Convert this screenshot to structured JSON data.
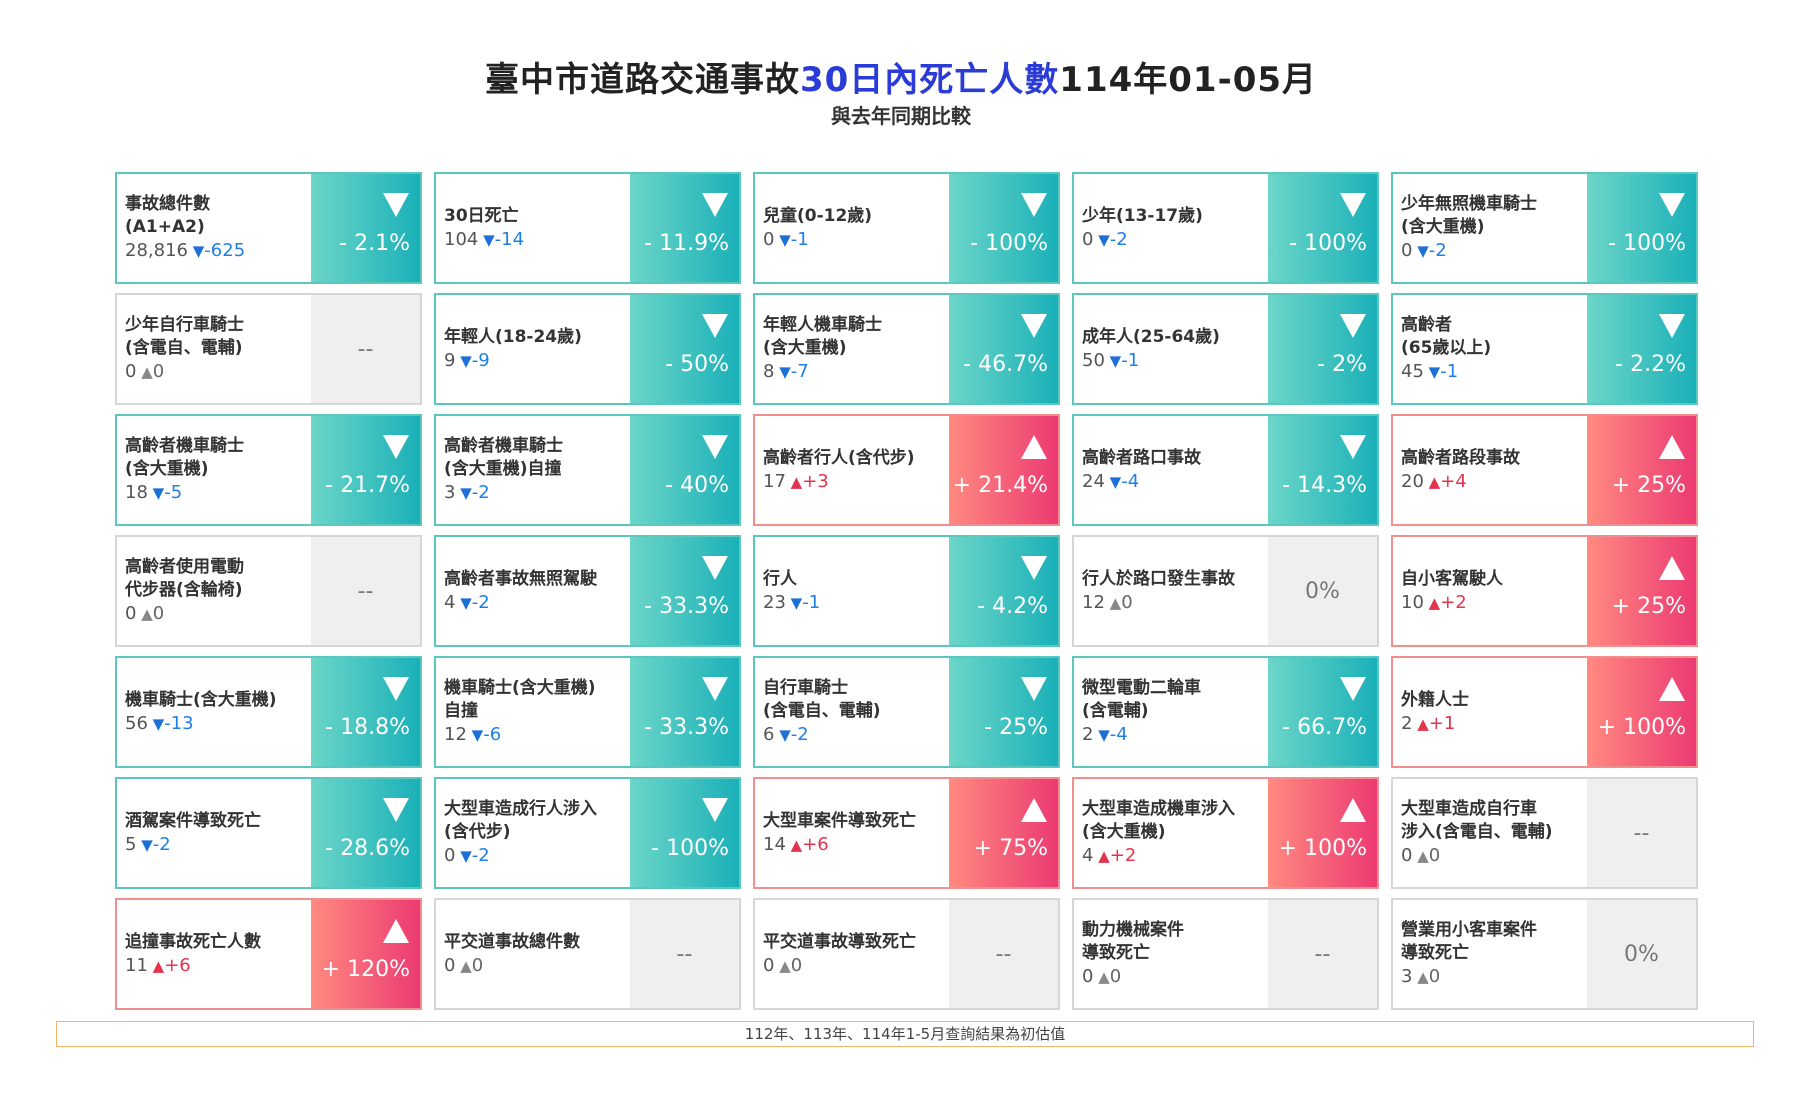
{
  "header": {
    "title_prefix": "臺中市道路交通事故",
    "title_highlight": "30日內死亡人數",
    "title_suffix": "114年01-05月",
    "subtitle": "與去年同期比較"
  },
  "colors": {
    "down_gradient_start": "#6cd6c8",
    "down_gradient_end": "#1ab0b8",
    "up_gradient_start": "#ff8a80",
    "up_gradient_end": "#ec3a72",
    "flat_background": "#efefef",
    "title_highlight": "#2b3bd6",
    "note_border": "#f2b46a"
  },
  "icons": {
    "down": "down-triangle-icon",
    "up": "up-triangle-icon",
    "flat": "flat-triangle-icon"
  },
  "cards": [
    {
      "name": "事故總件數\n(A1+A2)",
      "value": "28,816",
      "delta": "-625",
      "dir": "down",
      "pct": "- 2.1%"
    },
    {
      "name": "30日死亡",
      "value": "104",
      "delta": "-14",
      "dir": "down",
      "pct": "- 11.9%"
    },
    {
      "name": "兒童(0-12歲)",
      "value": "0",
      "delta": "-1",
      "dir": "down",
      "pct": "- 100%"
    },
    {
      "name": "少年(13-17歲)",
      "value": "0",
      "delta": "-2",
      "dir": "down",
      "pct": "- 100%"
    },
    {
      "name": "少年無照機車騎士\n(含大重機)",
      "value": "0",
      "delta": "-2",
      "dir": "down",
      "pct": "- 100%"
    },
    {
      "name": "少年自行車騎士\n(含電自、電輔)",
      "value": "0",
      "delta": "0",
      "dir": "flat",
      "pct": "--"
    },
    {
      "name": "年輕人(18-24歲)",
      "value": "9",
      "delta": "-9",
      "dir": "down",
      "pct": "- 50%"
    },
    {
      "name": "年輕人機車騎士\n(含大重機)",
      "value": "8",
      "delta": "-7",
      "dir": "down",
      "pct": "- 46.7%"
    },
    {
      "name": "成年人(25-64歲)",
      "value": "50",
      "delta": "-1",
      "dir": "down",
      "pct": "- 2%"
    },
    {
      "name": "高齡者\n(65歲以上)",
      "value": "45",
      "delta": "-1",
      "dir": "down",
      "pct": "- 2.2%"
    },
    {
      "name": "高齡者機車騎士\n(含大重機)",
      "value": "18",
      "delta": "-5",
      "dir": "down",
      "pct": "- 21.7%"
    },
    {
      "name": "高齡者機車騎士\n(含大重機)自撞",
      "value": "3",
      "delta": "-2",
      "dir": "down",
      "pct": "- 40%"
    },
    {
      "name": "高齡者行人(含代步)",
      "value": "17",
      "delta": "+3",
      "dir": "up",
      "pct": "+ 21.4%"
    },
    {
      "name": "高齡者路口事故",
      "value": "24",
      "delta": "-4",
      "dir": "down",
      "pct": "- 14.3%"
    },
    {
      "name": "高齡者路段事故",
      "value": "20",
      "delta": "+4",
      "dir": "up",
      "pct": "+ 25%"
    },
    {
      "name": "高齡者使用電動\n代步器(含輪椅)",
      "value": "0",
      "delta": "0",
      "dir": "flat",
      "pct": "--"
    },
    {
      "name": "高齡者事故無照駕駛",
      "value": "4",
      "delta": "-2",
      "dir": "down",
      "pct": "- 33.3%"
    },
    {
      "name": "行人",
      "value": "23",
      "delta": "-1",
      "dir": "down",
      "pct": "- 4.2%"
    },
    {
      "name": "行人於路口發生事故",
      "value": "12",
      "delta": "0",
      "dir": "flat",
      "pct": "0%"
    },
    {
      "name": "自小客駕駛人",
      "value": "10",
      "delta": "+2",
      "dir": "up",
      "pct": "+ 25%"
    },
    {
      "name": "機車騎士(含大重機)",
      "value": "56",
      "delta": "-13",
      "dir": "down",
      "pct": "- 18.8%"
    },
    {
      "name": "機車騎士(含大重機)\n自撞",
      "value": "12",
      "delta": "-6",
      "dir": "down",
      "pct": "- 33.3%"
    },
    {
      "name": "自行車騎士\n(含電自、電輔)",
      "value": "6",
      "delta": "-2",
      "dir": "down",
      "pct": "- 25%"
    },
    {
      "name": "微型電動二輪車\n(含電輔)",
      "value": "2",
      "delta": "-4",
      "dir": "down",
      "pct": "- 66.7%"
    },
    {
      "name": "外籍人士",
      "value": "2",
      "delta": "+1",
      "dir": "up",
      "pct": "+ 100%"
    },
    {
      "name": "酒駕案件導致死亡",
      "value": "5",
      "delta": "-2",
      "dir": "down",
      "pct": "- 28.6%"
    },
    {
      "name": "大型車造成行人涉入\n(含代步)",
      "value": "0",
      "delta": "-2",
      "dir": "down",
      "pct": "- 100%"
    },
    {
      "name": "大型車案件導致死亡",
      "value": "14",
      "delta": "+6",
      "dir": "up",
      "pct": "+ 75%"
    },
    {
      "name": "大型車造成機車涉入\n(含大重機)",
      "value": "4",
      "delta": "+2",
      "dir": "up",
      "pct": "+ 100%"
    },
    {
      "name": "大型車造成自行車\n涉入(含電自、電輔)",
      "value": "0",
      "delta": "0",
      "dir": "flat",
      "pct": "--"
    },
    {
      "name": "追撞事故死亡人數",
      "value": "11",
      "delta": "+6",
      "dir": "up",
      "pct": "+ 120%"
    },
    {
      "name": "平交道事故總件數",
      "value": "0",
      "delta": "0",
      "dir": "flat",
      "pct": "--"
    },
    {
      "name": "平交道事故導致死亡",
      "value": "0",
      "delta": "0",
      "dir": "flat",
      "pct": "--"
    },
    {
      "name": "動力機械案件\n導致死亡",
      "value": "0",
      "delta": "0",
      "dir": "flat",
      "pct": "--"
    },
    {
      "name": "營業用小客車案件\n導致死亡",
      "value": "3",
      "delta": "0",
      "dir": "flat",
      "pct": "0%"
    }
  ],
  "footer": {
    "note": "112年、113年、114年1-5月查詢結果為初估值"
  }
}
